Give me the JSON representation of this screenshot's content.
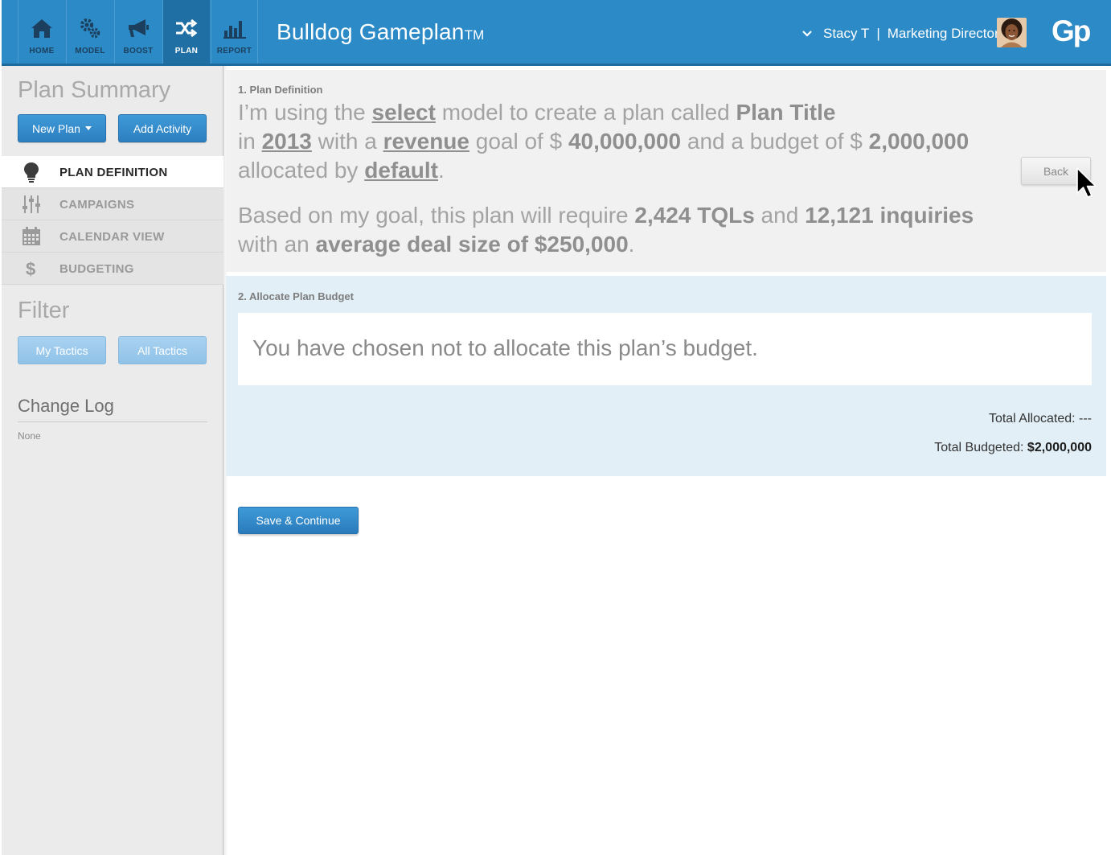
{
  "nav": {
    "tabs": [
      {
        "label": "HOME",
        "icon": "home-icon"
      },
      {
        "label": "MODEL",
        "icon": "gears-icon"
      },
      {
        "label": "BOOST",
        "icon": "megaphone-icon"
      },
      {
        "label": "PLAN",
        "icon": "shuffle-icon",
        "active": true
      },
      {
        "label": "REPORT",
        "icon": "bar-chart-icon"
      }
    ],
    "app_title": "Bulldog Gameplan",
    "app_title_tm": "TM",
    "user_name": "Stacy T",
    "user_separator": "|",
    "user_role": "Marketing Director",
    "logo": "Gp"
  },
  "sidebar": {
    "title": "Plan Summary",
    "new_plan_label": "New Plan",
    "add_activity_label": "Add Activity",
    "menu": [
      {
        "label": "PLAN DEFINITION",
        "icon": "lightbulb-icon",
        "active": true
      },
      {
        "label": "CAMPAIGNS",
        "icon": "sliders-icon"
      },
      {
        "label": "CALENDAR VIEW",
        "icon": "calendar-icon"
      },
      {
        "label": "BUDGETING",
        "icon": "dollar-icon"
      }
    ],
    "filter_title": "Filter",
    "my_tactics_label": "My Tactics",
    "all_tactics_label": "All Tactics",
    "change_log_title": "Change Log",
    "change_log_value": "None"
  },
  "definition": {
    "heading": "1. Plan Definition",
    "t1": "I’m using the ",
    "model": "select",
    "t2": " model to create a plan called ",
    "plan_title": "Plan Title",
    "t3": "in ",
    "year": "2013",
    "t4": " with a ",
    "goal_type": "revenue",
    "t5": " goal of $ ",
    "goal_amount": "40,000,000",
    "t6": " and a budget of $ ",
    "budget_amount": "2,000,000",
    "t7": "allocated by ",
    "allocation": "default",
    "t8": ".",
    "r1": "Based on my goal, this plan will require ",
    "tqls": "2,424 TQLs",
    "r2": " and ",
    "inquiries": "12,121 inquiries",
    "r3": " with an ",
    "deal_size": "average deal size of $250,000",
    "r4": ".",
    "back_label": "Back"
  },
  "allocate": {
    "heading": "2. Allocate Plan Budget",
    "notice": "You have chosen not to allocate this plan’s budget.",
    "allocated_label": "Total Allocated: ",
    "allocated_value": "---",
    "budgeted_label": "Total Budgeted: ",
    "budgeted_value": "$2,000,000"
  },
  "save_label": "Save & Continue",
  "colors": {
    "topbar": "#2c8ac7",
    "topbar_active": "#1f6fa4",
    "sidebar": "#ebebeb",
    "section1": "#f1f1f1",
    "section2": "#e2eff7",
    "button_blue": "#2c7fc0"
  }
}
